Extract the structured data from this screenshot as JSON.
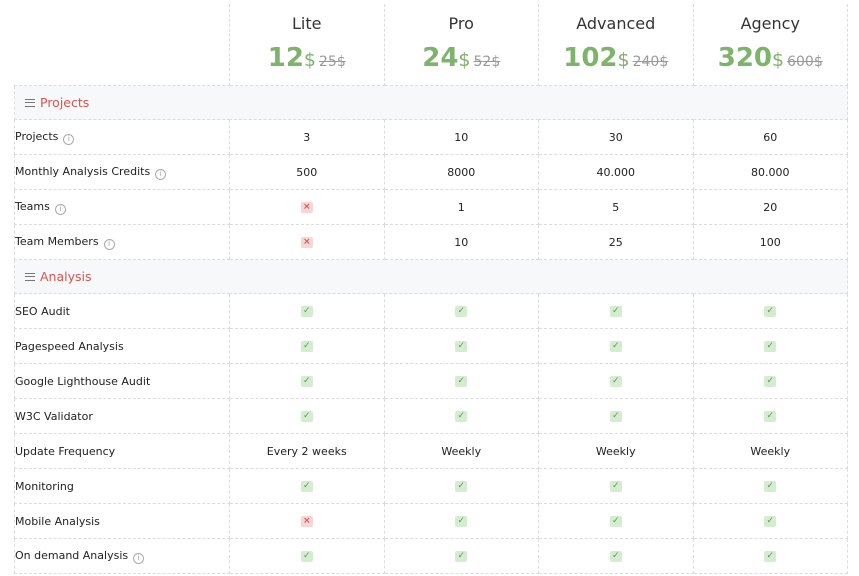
{
  "plans": [
    {
      "name": "Lite",
      "price": "12",
      "currency": "$",
      "old_price": "25$"
    },
    {
      "name": "Pro",
      "price": "24",
      "currency": "$",
      "old_price": "52$"
    },
    {
      "name": "Advanced",
      "price": "102",
      "currency": "$",
      "old_price": "240$"
    },
    {
      "name": "Agency",
      "price": "320",
      "currency": "$",
      "old_price": "600$"
    }
  ],
  "icons": {
    "section": "menu-icon",
    "info": "info-icon",
    "yes": "check-icon",
    "no": "cross-icon"
  },
  "colors": {
    "price": "#7db36b",
    "section_title": "#d9534f",
    "check_bg": "#d4ecd0",
    "cross_bg": "#f7d6d6"
  },
  "sections": [
    {
      "title": "Projects",
      "rows": [
        {
          "label": "Projects",
          "info": true,
          "values": [
            "3",
            "10",
            "30",
            "60"
          ]
        },
        {
          "label": "Monthly Analysis Credits",
          "info": true,
          "values": [
            "500",
            "8000",
            "40.000",
            "80.000"
          ]
        },
        {
          "label": "Teams",
          "info": true,
          "values": [
            "no",
            "1",
            "5",
            "20"
          ]
        },
        {
          "label": "Team Members",
          "info": true,
          "values": [
            "no",
            "10",
            "25",
            "100"
          ]
        }
      ]
    },
    {
      "title": "Analysis",
      "rows": [
        {
          "label": "SEO Audit",
          "info": false,
          "values": [
            "yes",
            "yes",
            "yes",
            "yes"
          ]
        },
        {
          "label": "Pagespeed Analysis",
          "info": false,
          "values": [
            "yes",
            "yes",
            "yes",
            "yes"
          ]
        },
        {
          "label": "Google Lighthouse Audit",
          "info": false,
          "values": [
            "yes",
            "yes",
            "yes",
            "yes"
          ]
        },
        {
          "label": "W3C Validator",
          "info": false,
          "values": [
            "yes",
            "yes",
            "yes",
            "yes"
          ]
        },
        {
          "label": "Update Frequency",
          "info": false,
          "values": [
            "Every 2 weeks",
            "Weekly",
            "Weekly",
            "Weekly"
          ]
        },
        {
          "label": "Monitoring",
          "info": false,
          "values": [
            "yes",
            "yes",
            "yes",
            "yes"
          ]
        },
        {
          "label": "Mobile Analysis",
          "info": false,
          "values": [
            "no",
            "yes",
            "yes",
            "yes"
          ]
        },
        {
          "label": "On demand Analysis",
          "info": true,
          "values": [
            "yes",
            "yes",
            "yes",
            "yes"
          ]
        }
      ]
    }
  ]
}
